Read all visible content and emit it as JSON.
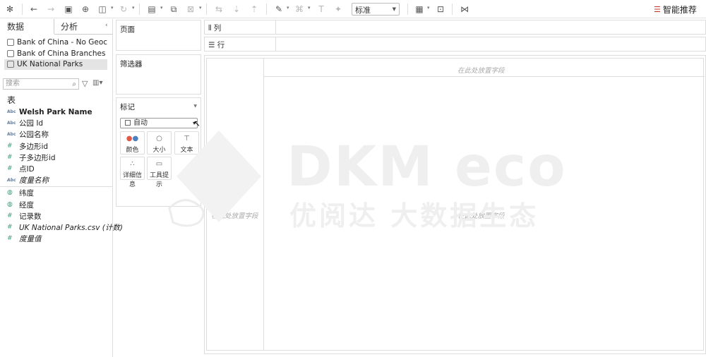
{
  "toolbar": {
    "fit_value": "标准",
    "smart_label": "智能推荐"
  },
  "left_pane": {
    "tab_data": "数据",
    "tab_analysis": "分析",
    "datasources": [
      {
        "label": "Bank of China - No Geoc..."
      },
      {
        "label": "Bank of China Branches"
      },
      {
        "label": "UK National Parks",
        "selected": true
      }
    ],
    "search_placeholder": "搜索",
    "tables_title": "表",
    "fields": [
      {
        "icon": "Abc",
        "label": "Welsh Park Name",
        "bold": true
      },
      {
        "icon": "Abc",
        "label": "公园 Id"
      },
      {
        "icon": "Abc",
        "label": "公园名称"
      },
      {
        "icon": "#",
        "label": "多边形id"
      },
      {
        "icon": "#",
        "label": "子多边形id"
      },
      {
        "icon": "#",
        "label": "点ID"
      },
      {
        "icon": "Abc",
        "label": "度量名称",
        "italic": true
      },
      {
        "icon": "globe",
        "label": "纬度"
      },
      {
        "icon": "globe",
        "label": "经度"
      },
      {
        "icon": "#",
        "label": "记录数"
      },
      {
        "icon": "#",
        "label": "UK National Parks.csv (计数)",
        "italic": true
      },
      {
        "icon": "#",
        "label": "度量值",
        "italic": true
      }
    ]
  },
  "cards": {
    "pages": "页面",
    "filters": "筛选器",
    "marks": "标记",
    "mark_type": "自动",
    "buttons": [
      {
        "label": "颜色"
      },
      {
        "label": "大小"
      },
      {
        "label": "文本"
      },
      {
        "label": "详细信息"
      },
      {
        "label": "工具提示"
      }
    ]
  },
  "shelves": {
    "columns": "列",
    "rows": "行"
  },
  "canvas": {
    "drop_top": "在此处放置字段",
    "drop_left": "在此处放置字段",
    "drop_center": "在此处放置字段"
  },
  "watermark": {
    "main": "DKM eco",
    "sub": "优阅达 大数据生态"
  }
}
